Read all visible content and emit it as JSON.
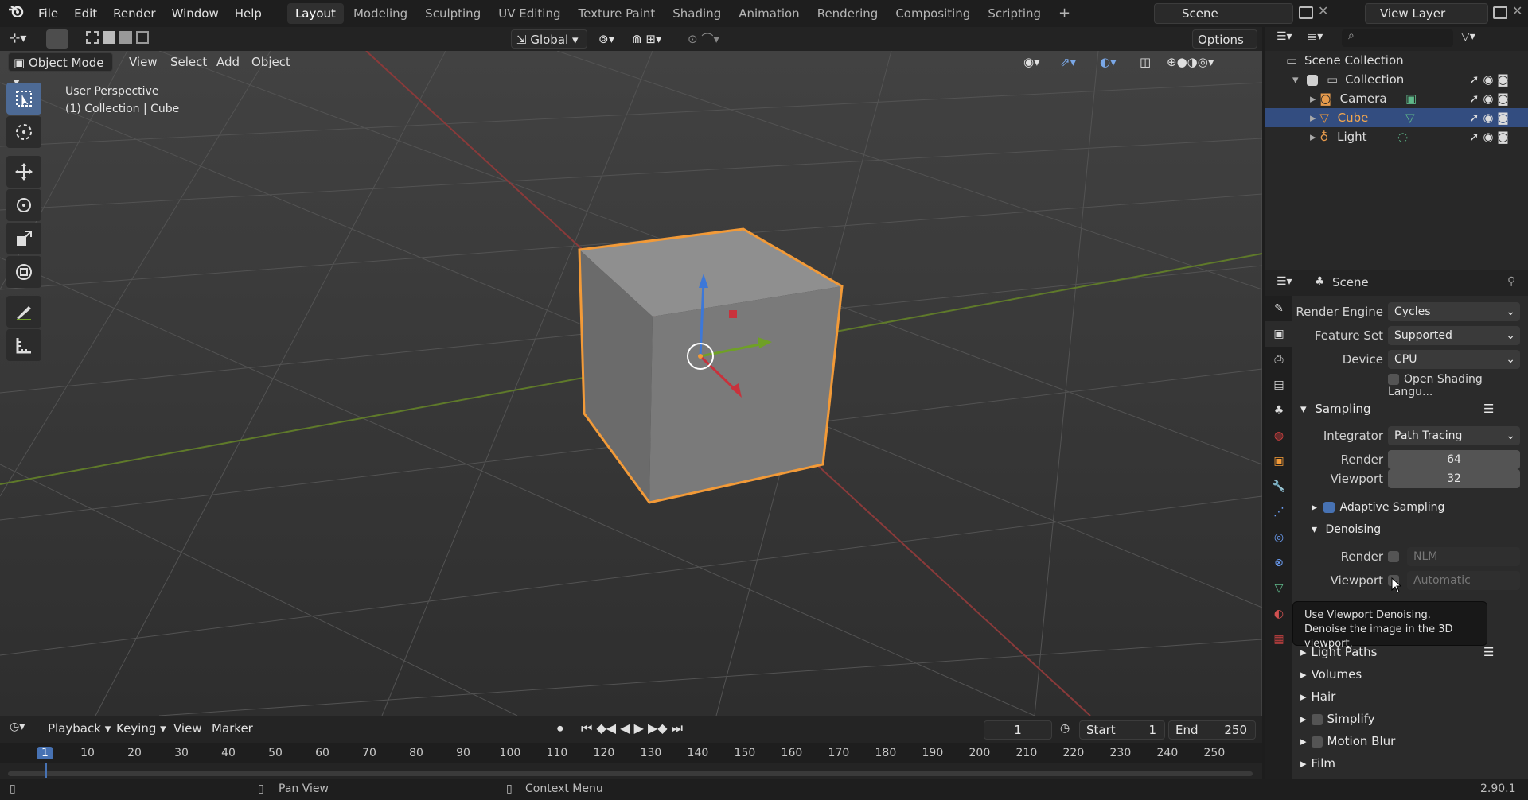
{
  "menu": {
    "file": "File",
    "edit": "Edit",
    "render": "Render",
    "window": "Window",
    "help": "Help"
  },
  "workspaces": [
    "Layout",
    "Modeling",
    "Sculpting",
    "UV Editing",
    "Texture Paint",
    "Shading",
    "Animation",
    "Rendering",
    "Compositing",
    "Scripting"
  ],
  "scene_field": "Scene",
  "view_layer_field": "View Layer",
  "tool_header": {
    "orientation": "Global",
    "options": "Options"
  },
  "vp_header": {
    "mode": "Object Mode",
    "view": "View",
    "select": "Select",
    "add": "Add",
    "object": "Object"
  },
  "viewport_info": {
    "line1": "User Perspective",
    "line2": "(1) Collection | Cube"
  },
  "outliner": {
    "root": "Scene Collection",
    "collection": "Collection",
    "items": [
      "Camera",
      "Cube",
      "Light"
    ]
  },
  "properties": {
    "context": "Scene",
    "render_engine_label": "Render Engine",
    "render_engine": "Cycles",
    "feature_set_label": "Feature Set",
    "feature_set": "Supported",
    "device_label": "Device",
    "device": "CPU",
    "osl_label": "Open Shading Langu...",
    "sampling": "Sampling",
    "integrator_label": "Integrator",
    "integrator": "Path Tracing",
    "render_label": "Render",
    "render_samples": "64",
    "viewport_label": "Viewport",
    "viewport_samples": "32",
    "adaptive_sampling": "Adaptive Sampling",
    "denoising": "Denoising",
    "den_render_label": "Render",
    "den_render_val": "NLM",
    "den_viewport_label": "Viewport",
    "den_viewport_val": "Automatic",
    "light_paths": "Light Paths",
    "volumes": "Volumes",
    "hair": "Hair",
    "simplify": "Simplify",
    "motion_blur": "Motion Blur",
    "film": "Film"
  },
  "tooltip": {
    "line1": "Use Viewport Denoising.",
    "line2": "Denoise the image in the 3D viewport."
  },
  "timeline": {
    "playback": "Playback",
    "keying": "Keying",
    "view": "View",
    "marker": "Marker",
    "current_frame": "1",
    "start_label": "Start",
    "start": "1",
    "end_label": "End",
    "end": "250",
    "ticks": [
      "1",
      "10",
      "20",
      "30",
      "40",
      "50",
      "60",
      "70",
      "80",
      "90",
      "100",
      "110",
      "120",
      "130",
      "140",
      "150",
      "160",
      "170",
      "180",
      "190",
      "200",
      "210",
      "220",
      "230",
      "240",
      "250"
    ]
  },
  "status": {
    "pan": "Pan View",
    "context": "Context Menu",
    "version": "2.90.1"
  },
  "colors": {
    "accent": "#4772b3",
    "selected_outline": "#f29a38",
    "background": "#1d1d1d"
  }
}
